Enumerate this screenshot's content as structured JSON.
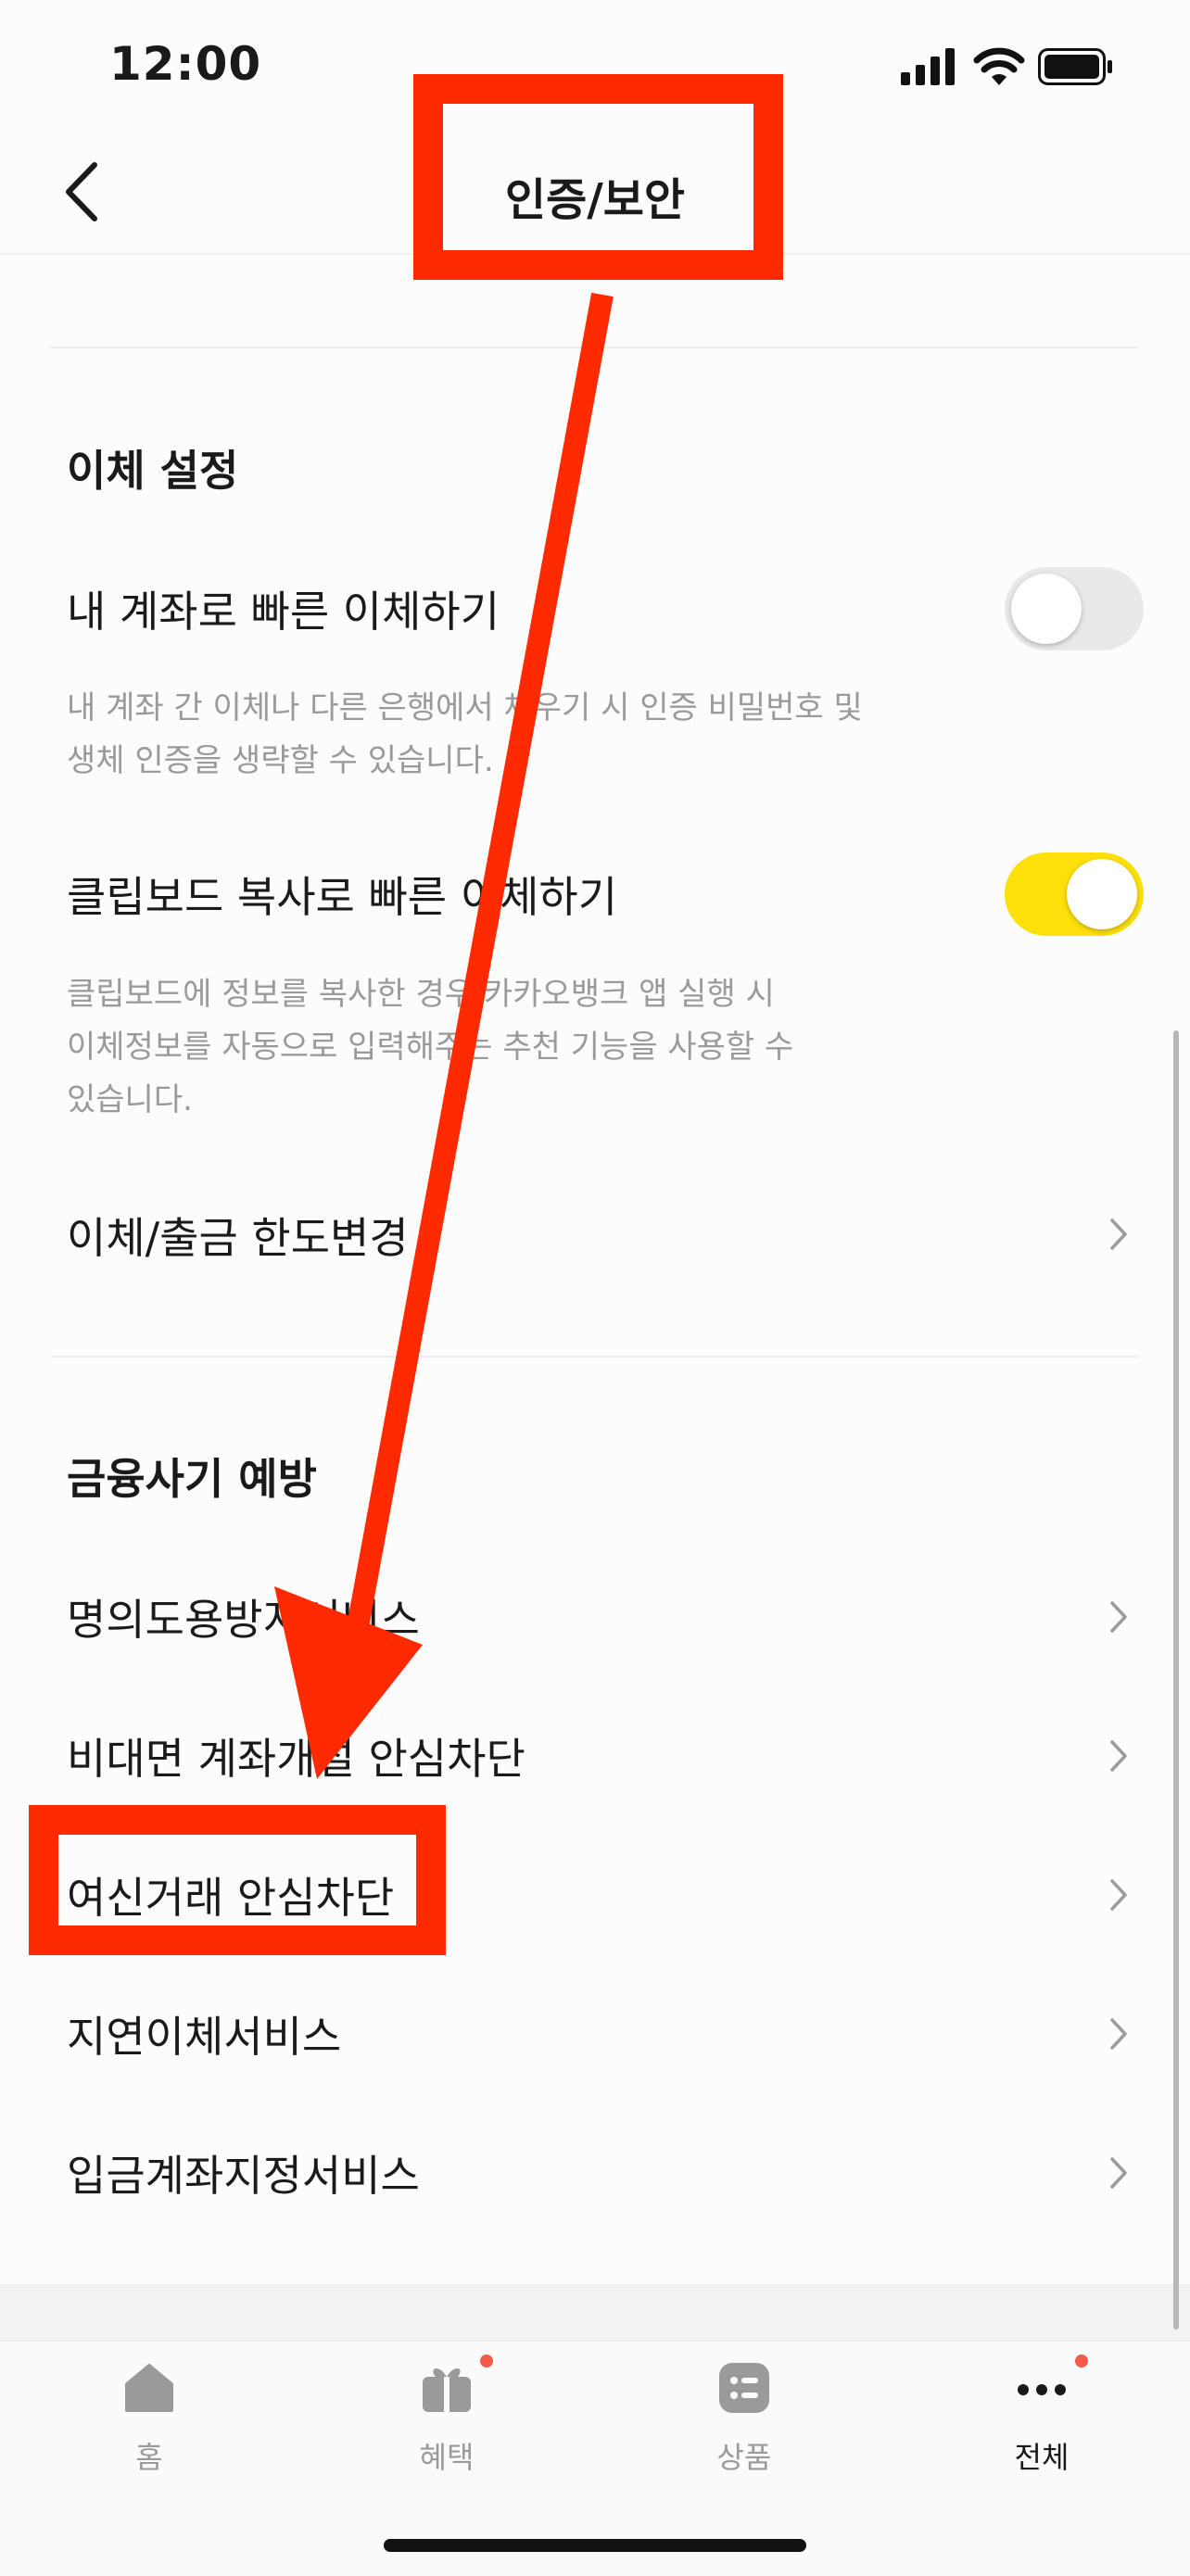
{
  "status_bar": {
    "time": "12:00"
  },
  "header": {
    "title": "인증/보안"
  },
  "transfer_section": {
    "title": "이체 설정",
    "items": [
      {
        "label": "내 계좌로 빠른 이체하기",
        "toggle_state": "off",
        "description_lines": [
          "내 계좌 간 이체나 다른 은행에서 채우기 시 인증 비밀번호 및",
          "생체 인증을 생략할 수 있습니다."
        ]
      },
      {
        "label": "클립보드 복사로 빠른 이체하기",
        "toggle_state": "on",
        "description_lines": [
          "클립보드에 정보를 복사한 경우 카카오뱅크 앱 실행 시",
          "이체정보를 자동으로 입력해주는 추천 기능을 사용할 수",
          "있습니다."
        ]
      },
      {
        "label": "이체/출금 한도변경"
      }
    ]
  },
  "fraud_section": {
    "title": "금융사기 예방",
    "items": [
      {
        "label": "명의도용방지서비스"
      },
      {
        "label": "비대면 계좌개설 안심차단"
      },
      {
        "label": "여신거래 안심차단"
      },
      {
        "label": "지연이체서비스"
      },
      {
        "label": "입금계좌지정서비스"
      }
    ]
  },
  "tab_bar": {
    "tabs": [
      {
        "label": "홈",
        "icon": "home-icon",
        "badge": false
      },
      {
        "label": "혜택",
        "icon": "gift-icon",
        "badge": true
      },
      {
        "label": "상품",
        "icon": "product-list-icon",
        "badge": false
      },
      {
        "label": "전체",
        "icon": "more-dots-icon",
        "badge": true,
        "active": true
      }
    ]
  },
  "colors": {
    "toggle_on": "#fde00a",
    "toggle_off": "#e9e9e9",
    "annotation_red": "#ff2a00",
    "badge_red": "#f25a4a"
  }
}
